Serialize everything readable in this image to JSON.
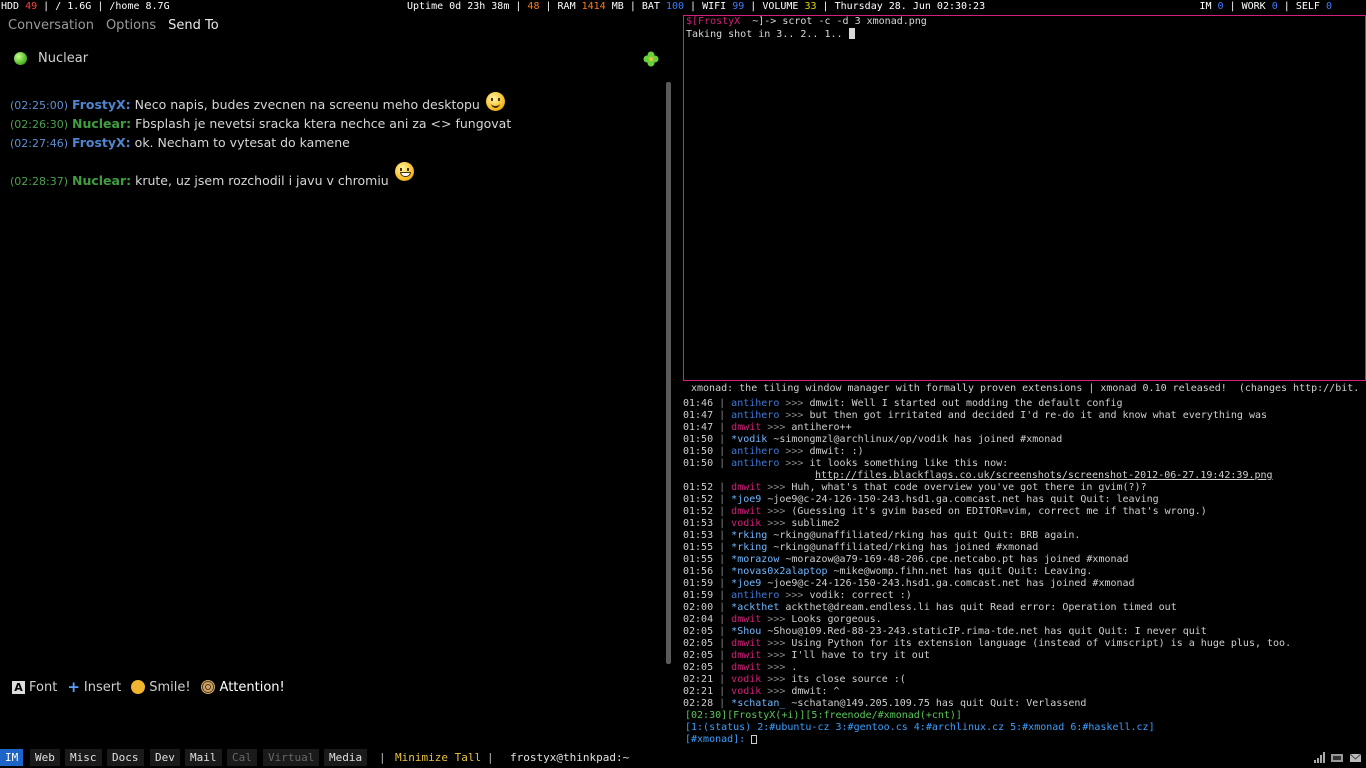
{
  "topbar": {
    "hdd_label": "HDD",
    "hdd_value": "49",
    "root": "/ 1.6G",
    "home": "/home 8.7G",
    "uptime": "Uptime 0d 23h 38m",
    "cpu": "48",
    "ram_label": "RAM",
    "ram_value": "1414",
    "ram_unit": "MB",
    "bat_label": "BAT",
    "bat_value": "100",
    "wifi_label": "WIFI",
    "wifi_value": "99",
    "volume_label": "VOLUME",
    "volume_value": "33",
    "date": "Thursday 28. Jun 02:30:23",
    "im_label": "IM",
    "im_value": "0",
    "work_label": "WORK",
    "work_value": "0",
    "self_label": "SELF",
    "self_value": "0"
  },
  "chat": {
    "menu": [
      "Conversation",
      "Options",
      "Send To"
    ],
    "contact": "Nuclear",
    "messages": [
      {
        "time": "(02:25:00)",
        "nick": "FrostyX:",
        "text": "Neco napis, budes zvecnen na screenu meho desktopu",
        "emote": "smile"
      },
      {
        "time": "(02:26:30)",
        "nick": "Nuclear:",
        "text": "Fbsplash je nevetsi sracka ktera nechce ani za <> fungovat"
      },
      {
        "time": "(02:27:46)",
        "nick": "FrostyX:",
        "text": "ok. Necham to vytesat do kamene"
      },
      {
        "time": "(02:28:37)",
        "nick": "Nuclear:",
        "text": "krute, uz jsem rozchodil i javu v chromiu",
        "emote": "grin"
      }
    ],
    "toolbar": {
      "font": "Font",
      "insert": "Insert",
      "smile": "Smile!",
      "attention": "Attention!"
    }
  },
  "terminal": {
    "prompt_user": "$[FrostyX",
    "prompt_rest": "~]-> scrot -c -d 3 xmonad.png",
    "output": "Taking shot in 3.. 2.. 1.. "
  },
  "irc": {
    "topic": "xmonad: the tiling window manager with formally proven extensions | xmonad 0.10 released!  (changes http://bit.",
    "lines": [
      {
        "t": "01:46",
        "n": "antihero",
        "m": "dmwit: Well I started out modding the default config"
      },
      {
        "t": "01:47",
        "n": "antihero",
        "m": "but then got irritated and decided I'd re-do it and know what everything was"
      },
      {
        "t": "01:47",
        "n": "dmwit",
        "m": "antihero++"
      },
      {
        "t": "01:50",
        "n": "*vodik",
        "m": "~simongmzl@archlinux/op/vodik has joined #xmonad"
      },
      {
        "t": "01:50",
        "n": "antihero",
        "m": "dmwit: :)"
      },
      {
        "t": "01:50",
        "n": "antihero",
        "m": "it looks something like this now:"
      },
      {
        "t": "",
        "n": "",
        "m": "http://files.blackflags.co.uk/screenshots/screenshot-2012-06-27.19:42:39.png"
      },
      {
        "t": "01:52",
        "n": "dmwit",
        "m": "Huh, what's that code overview you've got there in gvim(?)?"
      },
      {
        "t": "01:52",
        "n": "*joe9",
        "m": "~joe9@c-24-126-150-243.hsd1.ga.comcast.net has quit Quit: leaving"
      },
      {
        "t": "01:52",
        "n": "dmwit",
        "m": "(Guessing it's gvim based on EDITOR=vim, correct me if that's wrong.)"
      },
      {
        "t": "01:53",
        "n": "vodik",
        "m": "sublime2"
      },
      {
        "t": "01:53",
        "n": "*rking",
        "m": "~rking@unaffiliated/rking has quit Quit: BRB again."
      },
      {
        "t": "01:55",
        "n": "*rking",
        "m": "~rking@unaffiliated/rking has joined #xmonad"
      },
      {
        "t": "01:55",
        "n": "*morazow",
        "m": "~morazow@a79-169-48-206.cpe.netcabo.pt has joined #xmonad"
      },
      {
        "t": "01:56",
        "n": "*novas0x2alaptop",
        "m": "~mike@womp.fihn.net has quit Quit: Leaving."
      },
      {
        "t": "01:59",
        "n": "*joe9",
        "m": "~joe9@c-24-126-150-243.hsd1.ga.comcast.net has joined #xmonad"
      },
      {
        "t": "01:59",
        "n": "antihero",
        "m": "vodik: correct :)"
      },
      {
        "t": "02:00",
        "n": "*ackthet",
        "m": "ackthet@dream.endless.li has quit Read error: Operation timed out"
      },
      {
        "t": "02:04",
        "n": "dmwit",
        "m": "Looks gorgeous."
      },
      {
        "t": "02:05",
        "n": "*Shou",
        "m": "~Shou@109.Red-88-23-243.staticIP.rima-tde.net has quit Quit: I never quit"
      },
      {
        "t": "02:05",
        "n": "dmwit",
        "m": "Using Python for its extension language (instead of vimscript) is a huge plus, too."
      },
      {
        "t": "02:05",
        "n": "dmwit",
        "m": "I'll have to try it out"
      },
      {
        "t": "02:05",
        "n": "dmwit",
        "m": "."
      },
      {
        "t": "02:21",
        "n": "vodik",
        "m": "its close source :("
      },
      {
        "t": "02:21",
        "n": "vodik",
        "m": "dmwit: ^"
      },
      {
        "t": "02:28",
        "n": "*schatan_",
        "m": "~schatan@149.205.109.75 has quit Quit: Verlassend"
      }
    ],
    "status1": "[02:30][FrostyX(+i)][5:freenode/#xmonad(+cnt)]",
    "status2": "[1:(status) 2:#ubuntu-cz 3:#gentoo.cs 4:#archlinux.cz 5:#xmonad 6:#haskell.cz]",
    "input_prompt": "[#xmonad]: "
  },
  "bottombar": {
    "workspaces": [
      "IM",
      "Web",
      "Misc",
      "Docs",
      "Dev",
      "Mail",
      "Cal",
      "Virtual",
      "Media"
    ],
    "layout": "Minimize Tall",
    "window_title": "frostyx@thinkpad:~"
  },
  "colors": {
    "accent": "#1d64c8",
    "term_border": "#d61f7a"
  }
}
